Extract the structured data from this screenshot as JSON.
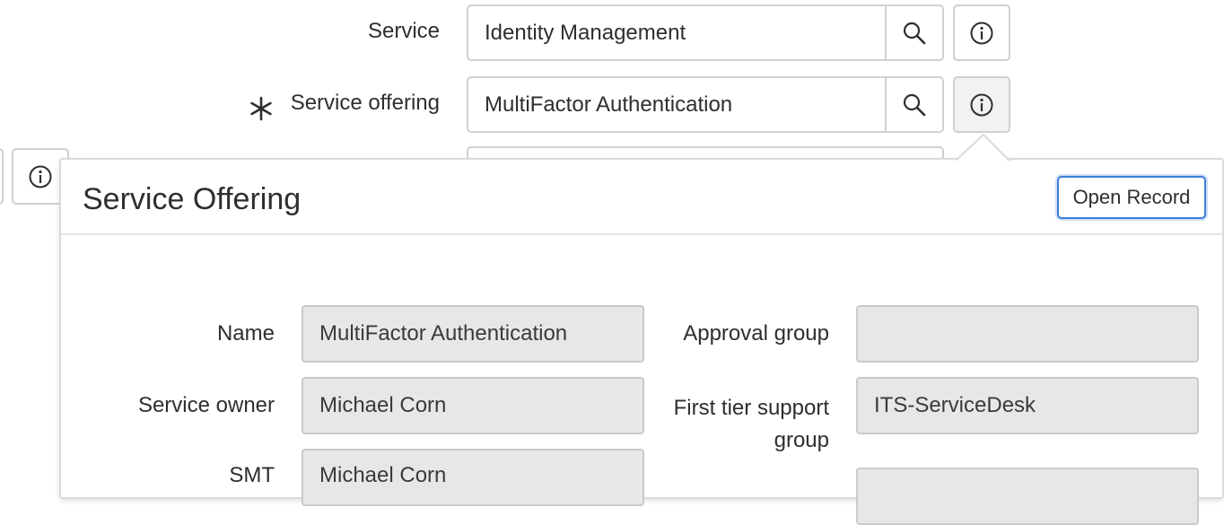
{
  "form": {
    "service": {
      "label": "Service",
      "value": "Identity Management"
    },
    "service_offering": {
      "label": "Service offering",
      "value": "MultiFactor Authentication",
      "required_marker": "*"
    }
  },
  "popover": {
    "title": "Service Offering",
    "open_record_label": "Open Record",
    "fields": {
      "name": {
        "label": "Name",
        "value": "MultiFactor Authentication"
      },
      "approval_group": {
        "label": "Approval group",
        "value": ""
      },
      "service_owner": {
        "label": "Service owner",
        "value": "Michael Corn"
      },
      "first_tier_support_group": {
        "label_line1": "First tier support",
        "label_line2": "group",
        "value": "ITS-ServiceDesk"
      },
      "smt": {
        "label": "SMT",
        "value": "Michael Corn"
      }
    }
  },
  "colors": {
    "focus_ring": "#3d7ed8",
    "readonly_bg": "#e6e7e8",
    "border": "#cfd0d2"
  }
}
